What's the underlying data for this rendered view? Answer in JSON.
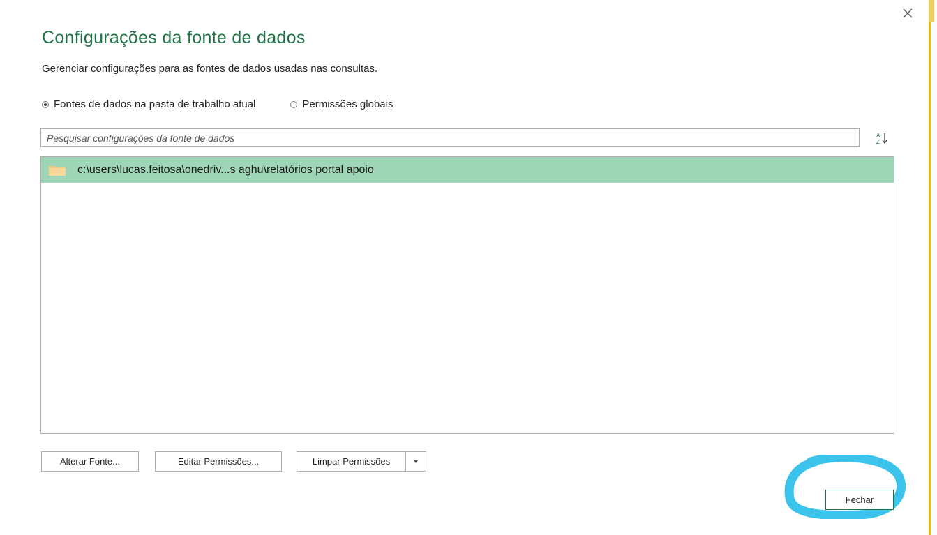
{
  "dialog": {
    "title": "Configurações da fonte de dados",
    "subtitle": "Gerenciar configurações para as fontes de dados usadas nas consultas."
  },
  "scope": {
    "options": [
      {
        "label": "Fontes de dados na pasta de trabalho atual",
        "checked": true
      },
      {
        "label": "Permissões globais",
        "checked": false
      }
    ]
  },
  "search": {
    "placeholder": "Pesquisar configurações da fonte de dados",
    "value": ""
  },
  "sort_icon": "sort-a-z-icon",
  "sources": [
    {
      "label": "c:\\users\\lucas.feitosa\\onedriv...s aghu\\relatórios portal apoio",
      "icon": "folder-icon",
      "selected": true
    }
  ],
  "buttons": {
    "change_source": "Alterar Fonte...",
    "edit_permissions": "Editar Permissões...",
    "clear_permissions": "Limpar Permissões",
    "close": "Fechar"
  },
  "colors": {
    "title": "#217346",
    "selected_row": "#9fd5b7",
    "annotation": "#3cc3ec",
    "accent_strip": "#e6b800"
  }
}
